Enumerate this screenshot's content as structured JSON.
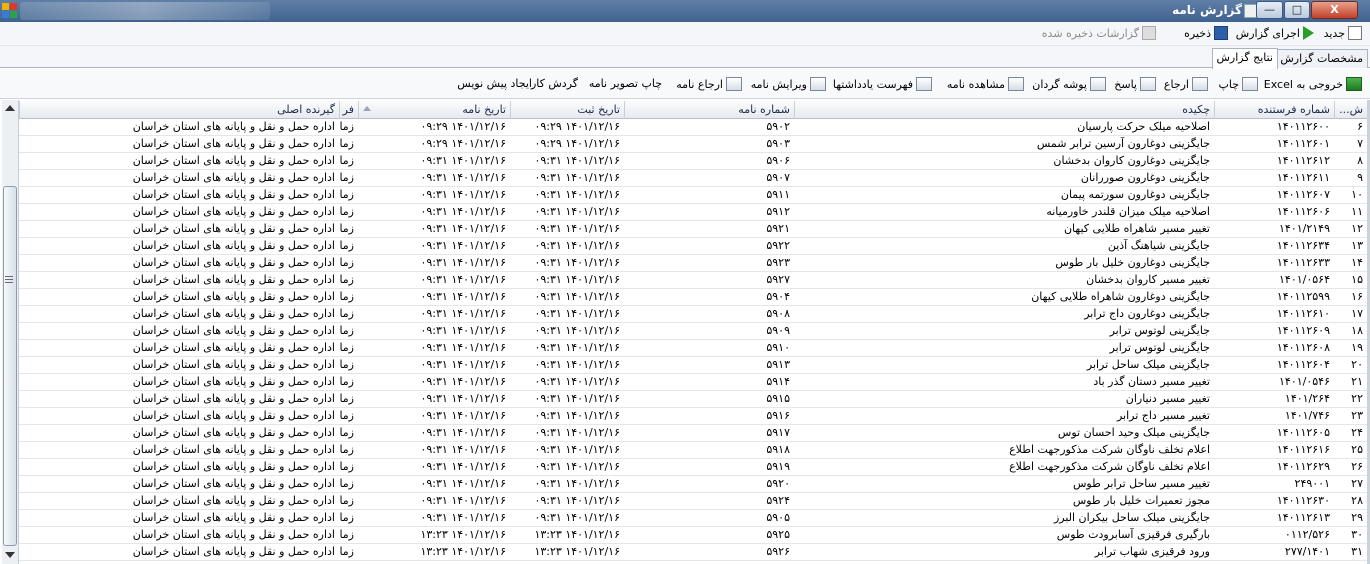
{
  "window": {
    "title": "گزارش نامه",
    "buttons": {
      "minimize": "—",
      "maximize": "□",
      "close": "X"
    }
  },
  "toolbar": {
    "new": "جدید",
    "run": "اجرای گزارش",
    "save": "ذخیره",
    "saved_reports": "گزارشات ذخیره شده"
  },
  "tabs": [
    {
      "label": "مشخصات گزارش"
    },
    {
      "label": "نتایج گزارش"
    }
  ],
  "actions": [
    {
      "label": "خروجی به Excel"
    },
    {
      "label": "چاپ"
    },
    {
      "label": "ارجاع"
    },
    {
      "label": "پاسخ"
    },
    {
      "label": "پوشه گردان"
    },
    {
      "label": "مشاهده نامه"
    },
    {
      "label": "فهرست یادداشتها"
    },
    {
      "label": "ویرایش نامه"
    },
    {
      "label": "ارجاع نامه"
    },
    {
      "label": "چاپ تصویر نامه"
    },
    {
      "label": "گردش کار"
    },
    {
      "label": "ایجاد پیش نویس"
    }
  ],
  "columns": {
    "row": "ش...",
    "sender_no": "شماره فرستنده",
    "summary": "چکیده",
    "letter_no": "شماره نامه",
    "reg_date": "تاریخ ثبت",
    "letter_date": "تاریخ نامه",
    "sender": "فر",
    "recipient": "گیرنده اصلی"
  },
  "rows": [
    {
      "n": "۶",
      "sender_no": "۱۴۰۱۱۲۶۰۰",
      "summary": "اصلاحیه میلک حرکت پارسیان",
      "letter_no": "۵۹۰۲",
      "reg_date": "۱۴۰۱/۱۲/۱۶ ۰۹:۲۹",
      "letter_date": "۱۴۰۱/۱۲/۱۶ ۰۹:۲۹",
      "sender": "زما",
      "recipient": "اداره حمل و نقل و پایانه های استان خراسان"
    },
    {
      "n": "۷",
      "sender_no": "۱۴۰۱۱۲۶۰۱",
      "summary": "جایگزینی دوغارون آرسین ترابر شمس",
      "letter_no": "۵۹۰۳",
      "reg_date": "۱۴۰۱/۱۲/۱۶ ۰۹:۲۹",
      "letter_date": "۱۴۰۱/۱۲/۱۶ ۰۹:۲۹",
      "sender": "زما",
      "recipient": "اداره حمل و نقل و پایانه های استان خراسان"
    },
    {
      "n": "۸",
      "sender_no": "۱۴۰۱۱۲۶۱۲",
      "summary": "جایگزینی دوغارون کاروان بدخشان",
      "letter_no": "۵۹۰۶",
      "reg_date": "۱۴۰۱/۱۲/۱۶ ۰۹:۳۱",
      "letter_date": "۱۴۰۱/۱۲/۱۶ ۰۹:۳۱",
      "sender": "زما",
      "recipient": "اداره حمل و نقل و پایانه های استان خراسان"
    },
    {
      "n": "۹",
      "sender_no": "۱۴۰۱۱۲۶۱۱",
      "summary": "جایگزینی دوغارون صوررانان",
      "letter_no": "۵۹۰۷",
      "reg_date": "۱۴۰۱/۱۲/۱۶ ۰۹:۳۱",
      "letter_date": "۱۴۰۱/۱۲/۱۶ ۰۹:۳۱",
      "sender": "زما",
      "recipient": "اداره حمل و نقل و پایانه های استان خراسان"
    },
    {
      "n": "۱۰",
      "sender_no": "۱۴۰۱۱۲۶۰۷",
      "summary": "جایگزینی دوغارون سورتمه پیمان",
      "letter_no": "۵۹۱۱",
      "reg_date": "۱۴۰۱/۱۲/۱۶ ۰۹:۳۱",
      "letter_date": "۱۴۰۱/۱۲/۱۶ ۰۹:۳۱",
      "sender": "زما",
      "recipient": "اداره حمل و نقل و پایانه های استان خراسان"
    },
    {
      "n": "۱۱",
      "sender_no": "۱۴۰۱۱۲۶۰۶",
      "summary": "اصلاحیه میلک میزان قلندر خاورمیانه",
      "letter_no": "۵۹۱۲",
      "reg_date": "۱۴۰۱/۱۲/۱۶ ۰۹:۳۱",
      "letter_date": "۱۴۰۱/۱۲/۱۶ ۰۹:۳۱",
      "sender": "زما",
      "recipient": "اداره حمل و نقل و پایانه های استان خراسان"
    },
    {
      "n": "۱۲",
      "sender_no": "۱۴۰۱/۲۱۴۹",
      "summary": "تغییر مسیر شاهراه طلایی کیهان",
      "letter_no": "۵۹۲۱",
      "reg_date": "۱۴۰۱/۱۲/۱۶ ۰۹:۳۱",
      "letter_date": "۱۴۰۱/۱۲/۱۶ ۰۹:۳۱",
      "sender": "زما",
      "recipient": "اداره حمل و نقل و پایانه های استان خراسان"
    },
    {
      "n": "۱۳",
      "sender_no": "۱۴۰۱۱۲۶۳۴",
      "summary": "جایگزینی شیاهنگ آذین",
      "letter_no": "۵۹۲۲",
      "reg_date": "۱۴۰۱/۱۲/۱۶ ۰۹:۳۱",
      "letter_date": "۱۴۰۱/۱۲/۱۶ ۰۹:۳۱",
      "sender": "زما",
      "recipient": "اداره حمل و نقل و پایانه های استان خراسان"
    },
    {
      "n": "۱۴",
      "sender_no": "۱۴۰۱۱۲۶۳۳",
      "summary": "جایگزینی دوغارون خلیل بار طوس",
      "letter_no": "۵۹۲۳",
      "reg_date": "۱۴۰۱/۱۲/۱۶ ۰۹:۳۱",
      "letter_date": "۱۴۰۱/۱۲/۱۶ ۰۹:۳۱",
      "sender": "زما",
      "recipient": "اداره حمل و نقل و پایانه های استان خراسان"
    },
    {
      "n": "۱۵",
      "sender_no": "۱۴۰۱/۰۵۶۴",
      "summary": "تغییر مسیر کاروان بدخشان",
      "letter_no": "۵۹۲۷",
      "reg_date": "۱۴۰۱/۱۲/۱۶ ۰۹:۳۱",
      "letter_date": "۱۴۰۱/۱۲/۱۶ ۰۹:۳۱",
      "sender": "زما",
      "recipient": "اداره حمل و نقل و پایانه های استان خراسان"
    },
    {
      "n": "۱۶",
      "sender_no": "۱۴۰۱۱۲۵۹۹",
      "summary": "جایگزینی دوغارون شاهراه طلایی کیهان",
      "letter_no": "۵۹۰۴",
      "reg_date": "۱۴۰۱/۱۲/۱۶ ۰۹:۳۱",
      "letter_date": "۱۴۰۱/۱۲/۱۶ ۰۹:۳۱",
      "sender": "زما",
      "recipient": "اداره حمل و نقل و پایانه های استان خراسان"
    },
    {
      "n": "۱۷",
      "sender_no": "۱۴۰۱۱۲۶۱۰",
      "summary": "جایگزینی دوغارون داج ترابر",
      "letter_no": "۵۹۰۸",
      "reg_date": "۱۴۰۱/۱۲/۱۶ ۰۹:۳۱",
      "letter_date": "۱۴۰۱/۱۲/۱۶ ۰۹:۳۱",
      "sender": "زما",
      "recipient": "اداره حمل و نقل و پایانه های استان خراسان"
    },
    {
      "n": "۱۸",
      "sender_no": "۱۴۰۱۱۲۶۰۹",
      "summary": "جایگزینی لوتوس ترابر",
      "letter_no": "۵۹۰۹",
      "reg_date": "۱۴۰۱/۱۲/۱۶ ۰۹:۳۱",
      "letter_date": "۱۴۰۱/۱۲/۱۶ ۰۹:۳۱",
      "sender": "زما",
      "recipient": "اداره حمل و نقل و پایانه های استان خراسان"
    },
    {
      "n": "۱۹",
      "sender_no": "۱۴۰۱۱۲۶۰۸",
      "summary": "جایگزینی لوتوس ترابر",
      "letter_no": "۵۹۱۰",
      "reg_date": "۱۴۰۱/۱۲/۱۶ ۰۹:۳۱",
      "letter_date": "۱۴۰۱/۱۲/۱۶ ۰۹:۳۱",
      "sender": "زما",
      "recipient": "اداره حمل و نقل و پایانه های استان خراسان"
    },
    {
      "n": "۲۰",
      "sender_no": "۱۴۰۱۱۲۶۰۴",
      "summary": "جایگزینی میلک ساحل ترابر",
      "letter_no": "۵۹۱۳",
      "reg_date": "۱۴۰۱/۱۲/۱۶ ۰۹:۳۱",
      "letter_date": "۱۴۰۱/۱۲/۱۶ ۰۹:۳۱",
      "sender": "زما",
      "recipient": "اداره حمل و نقل و پایانه های استان خراسان"
    },
    {
      "n": "۲۱",
      "sender_no": "۱۴۰۱/۰۵۴۶",
      "summary": "تغییر مسیر دستان گذر باد",
      "letter_no": "۵۹۱۴",
      "reg_date": "۱۴۰۱/۱۲/۱۶ ۰۹:۳۱",
      "letter_date": "۱۴۰۱/۱۲/۱۶ ۰۹:۳۱",
      "sender": "زما",
      "recipient": "اداره حمل و نقل و پایانه های استان خراسان"
    },
    {
      "n": "۲۲",
      "sender_no": "۱۴۰۱/۲۶۴",
      "summary": "تغییر مسیر دنیاران",
      "letter_no": "۵۹۱۵",
      "reg_date": "۱۴۰۱/۱۲/۱۶ ۰۹:۳۱",
      "letter_date": "۱۴۰۱/۱۲/۱۶ ۰۹:۳۱",
      "sender": "زما",
      "recipient": "اداره حمل و نقل و پایانه های استان خراسان"
    },
    {
      "n": "۲۳",
      "sender_no": "۱۴۰۱/۷۴۶",
      "summary": "تغییر مسیر داج ترابر",
      "letter_no": "۵۹۱۶",
      "reg_date": "۱۴۰۱/۱۲/۱۶ ۰۹:۳۱",
      "letter_date": "۱۴۰۱/۱۲/۱۶ ۰۹:۳۱",
      "sender": "زما",
      "recipient": "اداره حمل و نقل و پایانه های استان خراسان"
    },
    {
      "n": "۲۴",
      "sender_no": "۱۴۰۱۱۲۶۰۵",
      "summary": "جایگزینی میلک وحید احسان توس",
      "letter_no": "۵۹۱۷",
      "reg_date": "۱۴۰۱/۱۲/۱۶ ۰۹:۳۱",
      "letter_date": "۱۴۰۱/۱۲/۱۶ ۰۹:۳۱",
      "sender": "زما",
      "recipient": "اداره حمل و نقل و پایانه های استان خراسان"
    },
    {
      "n": "۲۵",
      "sender_no": "۱۴۰۱۱۲۶۱۶",
      "summary": "اعلام تخلف ناوگان شرکت مذکورجهت اطلاع",
      "letter_no": "۵۹۱۸",
      "reg_date": "۱۴۰۱/۱۲/۱۶ ۰۹:۳۱",
      "letter_date": "۱۴۰۱/۱۲/۱۶ ۰۹:۳۱",
      "sender": "زما",
      "recipient": "اداره حمل و نقل و پایانه های استان خراسان"
    },
    {
      "n": "۲۶",
      "sender_no": "۱۴۰۱۱۲۶۲۹",
      "summary": "اعلام تخلف ناوگان شرکت مذکورجهت اطلاع",
      "letter_no": "۵۹۱۹",
      "reg_date": "۱۴۰۱/۱۲/۱۶ ۰۹:۳۱",
      "letter_date": "۱۴۰۱/۱۲/۱۶ ۰۹:۳۱",
      "sender": "زما",
      "recipient": "اداره حمل و نقل و پایانه های استان خراسان"
    },
    {
      "n": "۲۷",
      "sender_no": "۲۴۹۰۰۱",
      "summary": "تغییر مسیر ساحل ترابر طوس",
      "letter_no": "۵۹۲۰",
      "reg_date": "۱۴۰۱/۱۲/۱۶ ۰۹:۳۱",
      "letter_date": "۱۴۰۱/۱۲/۱۶ ۰۹:۳۱",
      "sender": "زما",
      "recipient": "اداره حمل و نقل و پایانه های استان خراسان"
    },
    {
      "n": "۲۸",
      "sender_no": "۱۴۰۱۱۲۶۳۰",
      "summary": "مجوز تعمیرات خلیل بار طوس",
      "letter_no": "۵۹۲۴",
      "reg_date": "۱۴۰۱/۱۲/۱۶ ۰۹:۳۱",
      "letter_date": "۱۴۰۱/۱۲/۱۶ ۰۹:۳۱",
      "sender": "زما",
      "recipient": "اداره حمل و نقل و پایانه های استان خراسان"
    },
    {
      "n": "۲۹",
      "sender_no": "۱۴۰۱۱۲۶۱۳",
      "summary": "جایگزینی میلک ساحل بیکران البرز",
      "letter_no": "۵۹۰۵",
      "reg_date": "۱۴۰۱/۱۲/۱۶ ۰۹:۳۱",
      "letter_date": "۱۴۰۱/۱۲/۱۶ ۰۹:۳۱",
      "sender": "زما",
      "recipient": "اداره حمل و نقل و پایانه های استان خراسان"
    },
    {
      "n": "۳۰",
      "sender_no": "۰۱۱۲/۵۲۶",
      "summary": "بارگیری فرقیزی آسابرودت طوس",
      "letter_no": "۵۹۲۵",
      "reg_date": "۱۴۰۱/۱۲/۱۶ ۱۳:۲۳",
      "letter_date": "۱۴۰۱/۱۲/۱۶ ۱۳:۲۳",
      "sender": "زما",
      "recipient": "اداره حمل و نقل و پایانه های استان خراسان"
    },
    {
      "n": "۳۱",
      "sender_no": "۲۷۷/۱۴۰۱",
      "summary": "ورود فرقیزی شهاب ترابر",
      "letter_no": "۵۹۲۶",
      "reg_date": "۱۴۰۱/۱۲/۱۶ ۱۳:۲۳",
      "letter_date": "۱۴۰۱/۱۲/۱۶ ۱۳:۲۳",
      "sender": "زما",
      "recipient": "اداره حمل و نقل و پایانه های استان خراسان"
    }
  ]
}
